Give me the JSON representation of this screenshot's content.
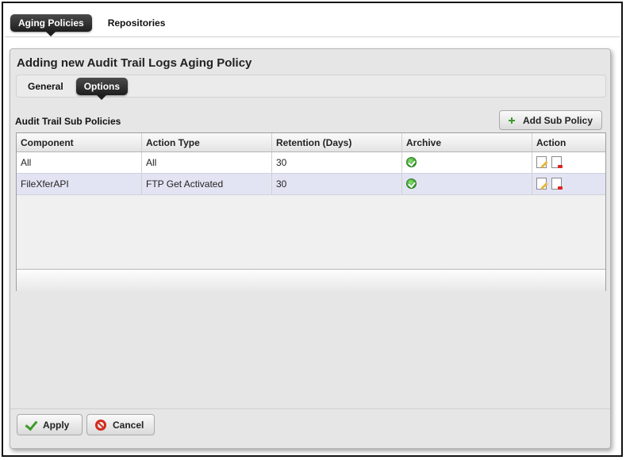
{
  "top_tabs": [
    {
      "label": "Aging Policies",
      "active": true
    },
    {
      "label": "Repositories",
      "active": false
    }
  ],
  "dialog": {
    "title": "Adding new Audit Trail Logs Aging Policy",
    "subtabs": [
      {
        "label": "General",
        "active": false
      },
      {
        "label": "Options",
        "active": true
      }
    ],
    "section_label": "Audit Trail Sub Policies",
    "add_button_label": "Add Sub Policy",
    "table": {
      "columns": [
        "Component",
        "Action Type",
        "Retention (Days)",
        "Archive",
        "Action"
      ],
      "rows": [
        {
          "component": "All",
          "action_type": "All",
          "retention": "30",
          "archive_icon": "check-circle-icon",
          "actions": [
            "edit-icon",
            "delete-icon"
          ]
        },
        {
          "component": "FileXferAPI",
          "action_type": "FTP Get Activated",
          "retention": "30",
          "archive_icon": "check-circle-icon",
          "actions": [
            "edit-icon",
            "delete-icon"
          ]
        }
      ]
    },
    "apply_label": "Apply",
    "cancel_label": "Cancel"
  },
  "colors": {
    "active_tab": "#1e1e1e",
    "row_alt": "#e3e4f3",
    "ok_green": "#2f9a24",
    "cancel_red": "#d32a1e"
  }
}
